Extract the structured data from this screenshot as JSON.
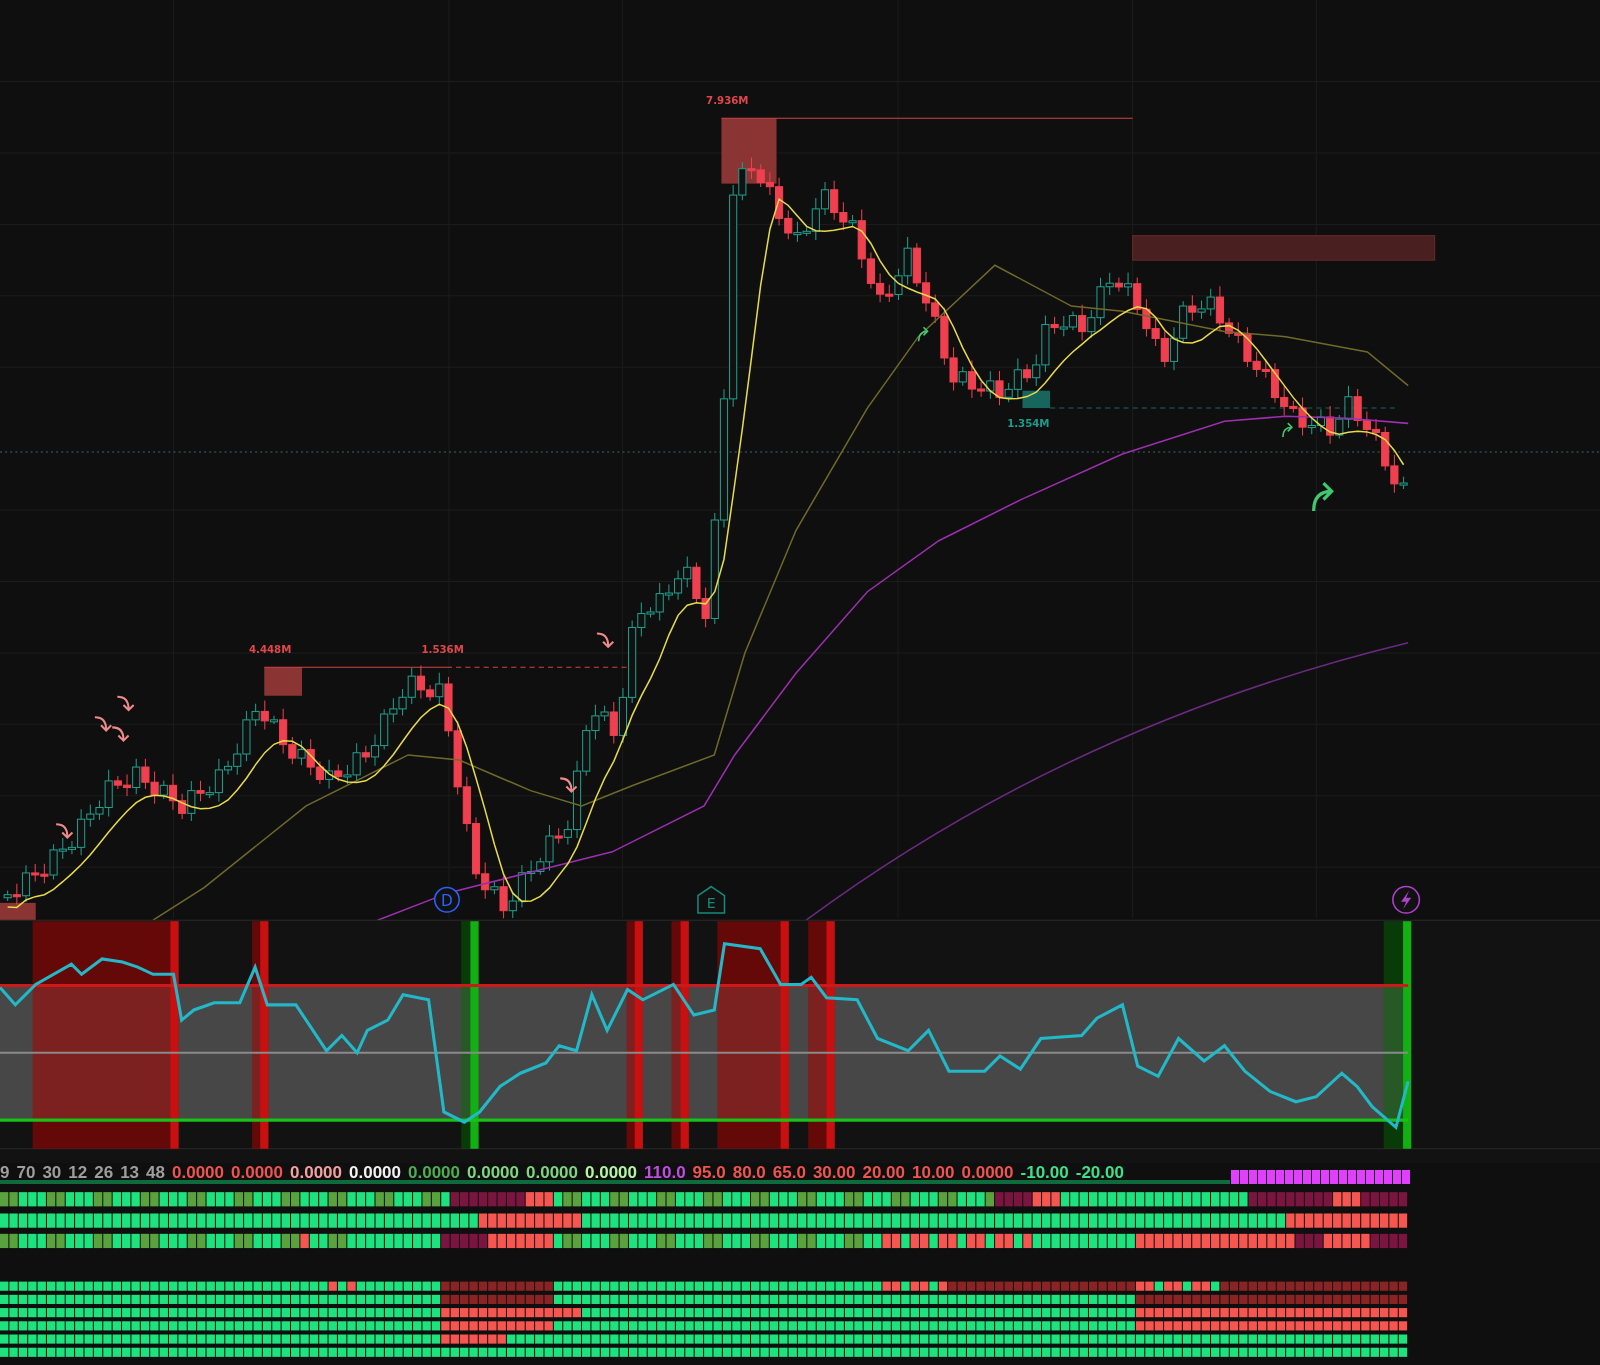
{
  "price_chart": {
    "volume_labels": [
      {
        "text": "7.936M",
        "color": "#e0474c"
      },
      {
        "text": "4.448M",
        "color": "#e0474c"
      },
      {
        "text": "1.536M",
        "color": "#e0474c"
      },
      {
        "text": "1.354M",
        "color": "#1a9c8c"
      }
    ],
    "event_markers": [
      {
        "kind": "dividend",
        "label": "D"
      },
      {
        "kind": "earnings",
        "label": "E"
      },
      {
        "kind": "flash"
      }
    ]
  },
  "indicator_values": [
    {
      "text": "9",
      "color": "#9e9e9e"
    },
    {
      "text": "70",
      "color": "#9e9e9e"
    },
    {
      "text": "30",
      "color": "#9e9e9e"
    },
    {
      "text": "12",
      "color": "#9e9e9e"
    },
    {
      "text": "26",
      "color": "#9e9e9e"
    },
    {
      "text": "13",
      "color": "#9e9e9e"
    },
    {
      "text": "48",
      "color": "#9e9e9e"
    },
    {
      "text": "0.0000",
      "color": "#f0544f"
    },
    {
      "text": "0.0000",
      "color": "#f0544f"
    },
    {
      "text": "0.0000",
      "color": "#f5a0a0"
    },
    {
      "text": "0.0000",
      "color": "#f2f2f2"
    },
    {
      "text": "0.0000",
      "color": "#4caf50"
    },
    {
      "text": "0.0000",
      "color": "#7ed67e"
    },
    {
      "text": "0.0000",
      "color": "#7ed67e"
    },
    {
      "text": "0.0000",
      "color": "#b4f5a0"
    },
    {
      "text": "110.0",
      "color": "#c04ee0"
    },
    {
      "text": "95.0",
      "color": "#f0544f"
    },
    {
      "text": "80.0",
      "color": "#f0544f"
    },
    {
      "text": "65.0",
      "color": "#f0544f"
    },
    {
      "text": "30.00",
      "color": "#f0544f"
    },
    {
      "text": "20.00",
      "color": "#f0544f"
    },
    {
      "text": "10.00",
      "color": "#f0544f"
    },
    {
      "text": "0.0000",
      "color": "#f0544f"
    },
    {
      "text": "-10.00",
      "color": "#3ee08a"
    },
    {
      "text": "-20.00",
      "color": "#3ee08a"
    }
  ]
}
